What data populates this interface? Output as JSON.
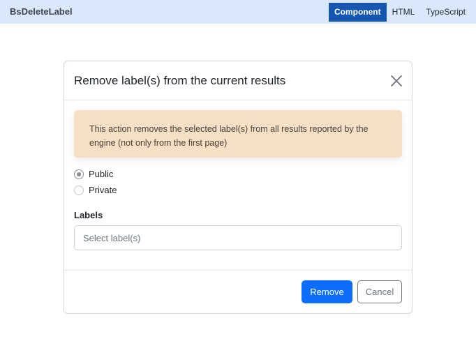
{
  "app": {
    "title": "BsDeleteLabel",
    "tabs": [
      {
        "label": "Component",
        "active": true
      },
      {
        "label": "HTML",
        "active": false
      },
      {
        "label": "TypeScript",
        "active": false
      }
    ]
  },
  "modal": {
    "title": "Remove label(s) from the current results",
    "close_icon": "close-icon",
    "alert_text": "This action removes the selected label(s) from all results reported by the engine (not only from the first page)",
    "visibility_options": [
      {
        "label": "Public",
        "checked": true
      },
      {
        "label": "Private",
        "checked": false
      }
    ],
    "labels_heading": "Labels",
    "labels_input": {
      "value": "",
      "placeholder": "Select label(s)"
    },
    "buttons": {
      "remove": "Remove",
      "cancel": "Cancel"
    }
  },
  "colors": {
    "topbar": "#dbe8fb",
    "active_tab": "#1557b0",
    "alert_bg": "#f5e0c5",
    "primary": "#0d6efd",
    "secondary": "#6c757d"
  }
}
